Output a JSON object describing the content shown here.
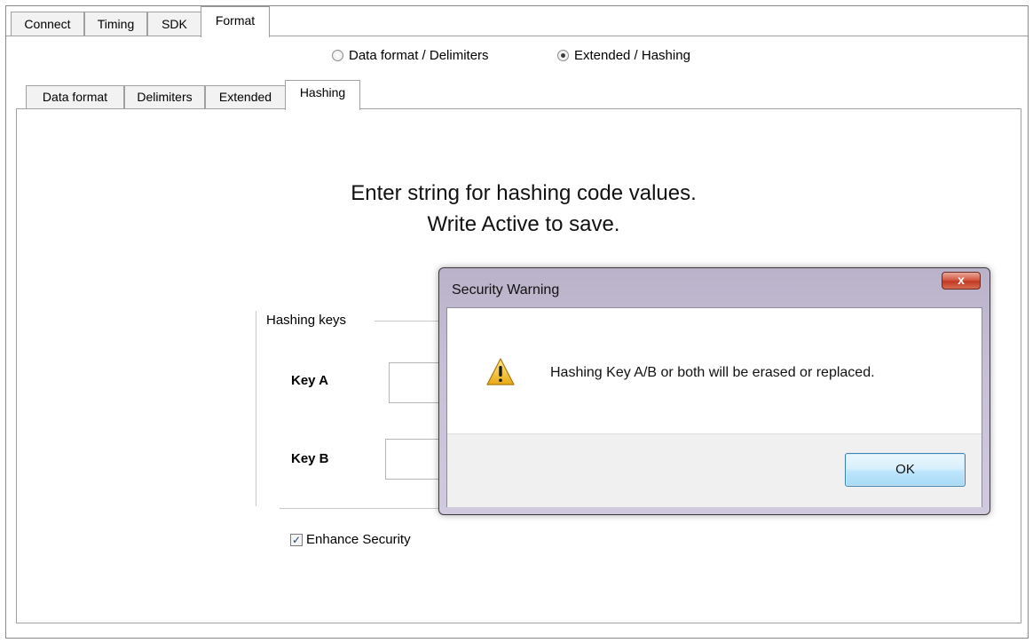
{
  "tabs": [
    "Connect",
    "Timing",
    "SDK",
    "Format"
  ],
  "active_tab": "Format",
  "mode_options": [
    {
      "label": "Data format / Delimiters",
      "selected": false
    },
    {
      "label": "Extended / Hashing",
      "selected": true
    }
  ],
  "sub_tabs": [
    "Data format",
    "Delimiters",
    "Extended",
    "Hashing"
  ],
  "active_sub_tab": "Hashing",
  "instructions": {
    "line1": "Enter string for hashing code values.",
    "line2": "Write Active to save."
  },
  "hashing": {
    "group_title": "Hashing keys",
    "key_a_label": "Key A",
    "key_a_value": "",
    "key_b_label": "Key B",
    "key_b_value": "",
    "enhance_security_label": "Enhance Security",
    "enhance_security_checked": true
  },
  "dialog": {
    "title": "Security Warning",
    "close_glyph": "x",
    "icon": "warning-icon",
    "message": "Hashing Key A/B or both will be erased or replaced.",
    "ok_label": "OK"
  },
  "colors": {
    "dialog_frame": "#c6bfd5",
    "close_button": "#c23b22",
    "ok_button": "#bee6fd",
    "warning_icon": "#f2c230"
  }
}
